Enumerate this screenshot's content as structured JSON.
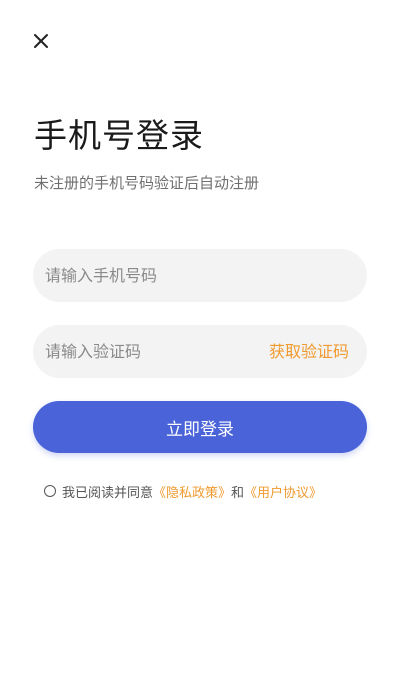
{
  "header": {
    "close_icon": "close-icon"
  },
  "title": "手机号登录",
  "subtitle": "未注册的手机号码验证后自动注册",
  "phone_field": {
    "placeholder": "请输入手机号码",
    "value": ""
  },
  "code_field": {
    "placeholder": "请输入验证码",
    "value": "",
    "get_code_label": "获取验证码"
  },
  "login_button": {
    "label": "立即登录"
  },
  "agreement": {
    "checked": false,
    "prefix": "我已阅读并同意",
    "privacy_link": "《隐私政策》",
    "and": "和",
    "user_agreement_link": "《用户协议》"
  },
  "colors": {
    "primary": "#4a63d9",
    "accent": "#f09a2f",
    "field_bg": "#f3f3f3",
    "title_text": "#1a1a1a",
    "subtitle_text": "#6f6f6f"
  }
}
